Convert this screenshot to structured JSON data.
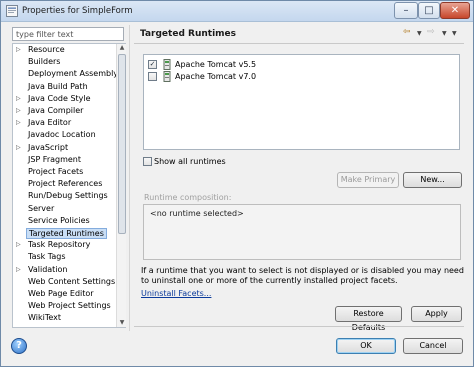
{
  "window": {
    "title": "Properties for SimpleForm"
  },
  "filter": {
    "placeholder": "type filter text"
  },
  "tree": {
    "items": [
      {
        "label": "Resource",
        "expandable": true
      },
      {
        "label": "Builders",
        "expandable": false
      },
      {
        "label": "Deployment Assembly",
        "expandable": false
      },
      {
        "label": "Java Build Path",
        "expandable": false
      },
      {
        "label": "Java Code Style",
        "expandable": true
      },
      {
        "label": "Java Compiler",
        "expandable": true
      },
      {
        "label": "Java Editor",
        "expandable": true
      },
      {
        "label": "Javadoc Location",
        "expandable": false
      },
      {
        "label": "JavaScript",
        "expandable": true
      },
      {
        "label": "JSP Fragment",
        "expandable": false
      },
      {
        "label": "Project Facets",
        "expandable": false
      },
      {
        "label": "Project References",
        "expandable": false
      },
      {
        "label": "Run/Debug Settings",
        "expandable": false
      },
      {
        "label": "Server",
        "expandable": false
      },
      {
        "label": "Service Policies",
        "expandable": false
      },
      {
        "label": "Targeted Runtimes",
        "expandable": false,
        "selected": true
      },
      {
        "label": "Task Repository",
        "expandable": true
      },
      {
        "label": "Task Tags",
        "expandable": false
      },
      {
        "label": "Validation",
        "expandable": true
      },
      {
        "label": "Web Content Settings",
        "expandable": false
      },
      {
        "label": "Web Page Editor",
        "expandable": false
      },
      {
        "label": "Web Project Settings",
        "expandable": false
      },
      {
        "label": "WikiText",
        "expandable": false
      }
    ]
  },
  "page": {
    "title": "Targeted Runtimes",
    "runtimes": [
      {
        "label": "Apache Tomcat v5.5",
        "checked": true
      },
      {
        "label": "Apache Tomcat v7.0",
        "checked": false
      }
    ],
    "show_all_label": "Show all runtimes",
    "make_primary_label": "Make Primary",
    "new_label": "New...",
    "composition_label": "Runtime composition:",
    "composition_value": "<no runtime selected>",
    "info_text": "If a runtime that you want to select is not displayed or is disabled you may need to uninstall one or more of the currently installed project facets.",
    "uninstall_link": "Uninstall Facets...",
    "restore_label": "Restore Defaults",
    "apply_label": "Apply"
  },
  "footer": {
    "ok_label": "OK",
    "cancel_label": "Cancel"
  },
  "colors": {
    "selection": "#c9def5",
    "link": "#0b3a9b",
    "close_button": "#c7462b"
  }
}
